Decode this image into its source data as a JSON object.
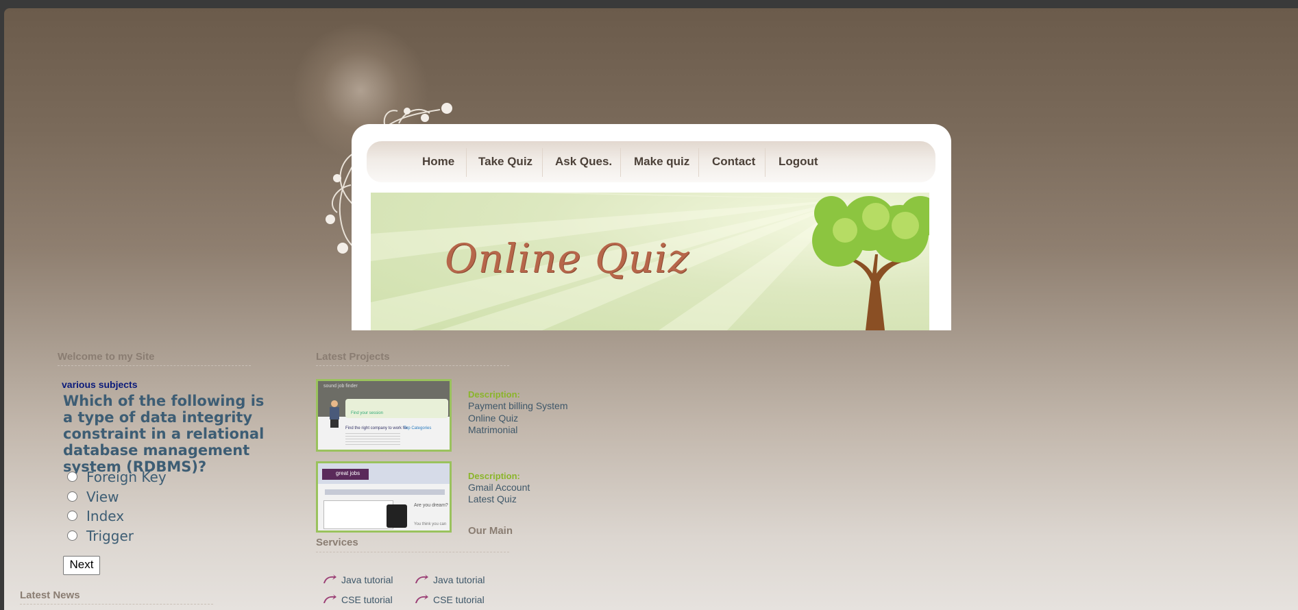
{
  "nav": {
    "items": [
      "Home",
      "Take Quiz",
      "Ask Ques.",
      "Make quiz",
      "Contact",
      "Logout"
    ]
  },
  "banner": {
    "title": "Online Quiz"
  },
  "welcome": {
    "heading": "Welcome to my Site",
    "marquee": "various subjects",
    "question": "Which of the following is a type of data integrity constraint in a relational database management system (RDBMS)?",
    "options": [
      "Foreign Key",
      "View",
      "Index",
      "Trigger"
    ],
    "next_label": "Next"
  },
  "latest_news": {
    "heading": "Latest News"
  },
  "projects": {
    "heading": "Latest Projects",
    "items": [
      {
        "label": "Description:",
        "lines": [
          "Payment billing System",
          "Online Quiz",
          "Matrimonial"
        ]
      },
      {
        "label": "Description:",
        "lines": [
          "Gmail Account",
          "Latest Quiz"
        ]
      }
    ]
  },
  "services": {
    "heading_part1": "Our Main",
    "heading_part2": "Services",
    "items": [
      "Java tutorial",
      "Java tutorial",
      "CSE tutorial",
      "CSE tutorial"
    ]
  },
  "thumb1": {
    "top_text": "sound job finder",
    "tag": "Find the right company to work for",
    "tag2": "Top Categories",
    "btn": "Find your session"
  },
  "thumb2": {
    "brand": "great jobs",
    "ask": "Are you dream?",
    "foot": "You think you can"
  },
  "colors": {
    "nav_text": "#4b4038",
    "question": "#3d5d74",
    "desc_label": "#8ab52a",
    "thumb_border": "#9ac25d"
  }
}
